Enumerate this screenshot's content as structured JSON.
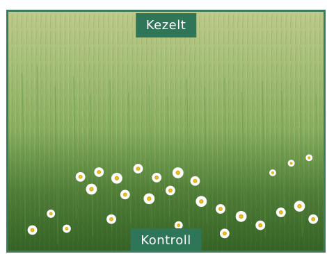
{
  "image": {
    "subject": "wheat-field-with-daisies",
    "labels": {
      "top": "Kezelt",
      "bottom": "Kontroll"
    }
  },
  "colors": {
    "frame_border": "#3a7a5d",
    "label_background": "#2f7558",
    "label_text": "#ffffff"
  }
}
